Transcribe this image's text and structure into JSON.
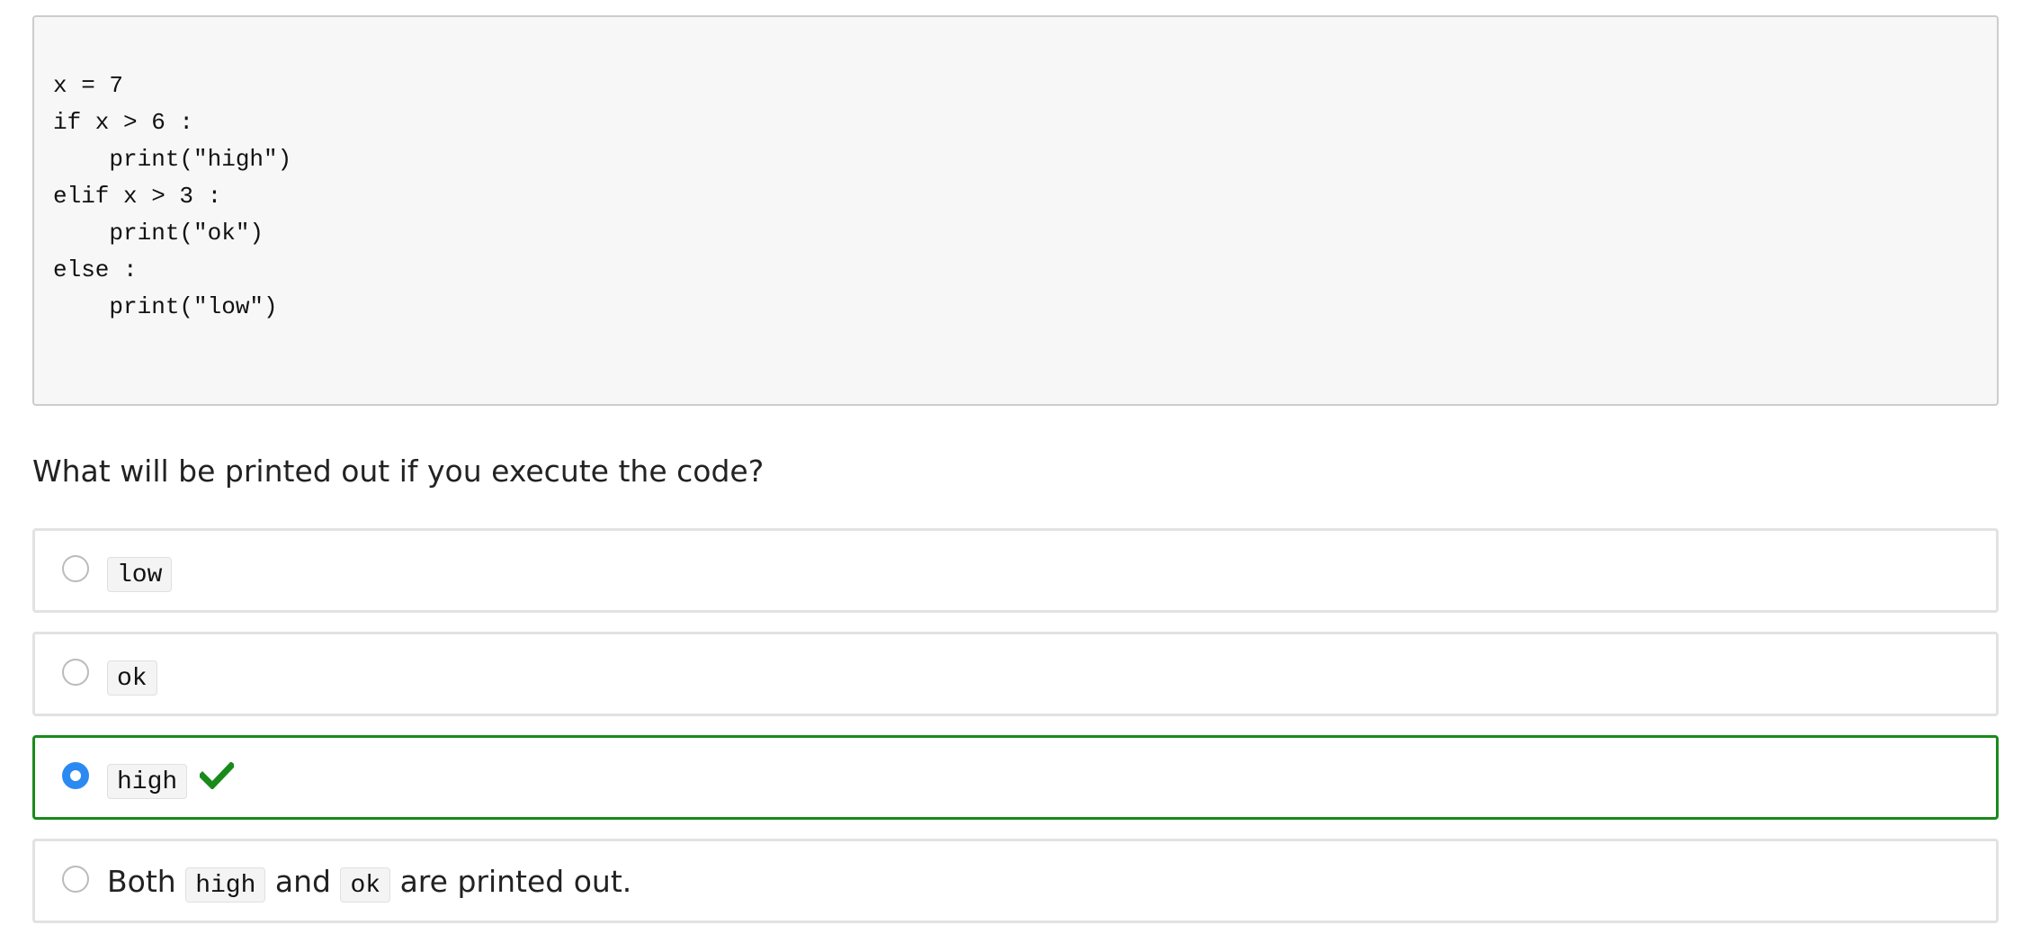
{
  "code": {
    "lines": [
      "x = 7",
      "if x > 6 :",
      "    print(\"high\")",
      "elif x > 3 :",
      "    print(\"ok\")",
      "else :",
      "    print(\"low\")"
    ]
  },
  "question": {
    "text": "What will be printed out if you execute the code?"
  },
  "options": [
    {
      "code": "low",
      "selected": false,
      "correct": false
    },
    {
      "code": "ok",
      "selected": false,
      "correct": false
    },
    {
      "code": "high",
      "selected": true,
      "correct": true
    },
    {
      "prefix": "Both ",
      "code1": "high",
      "middle": " and ",
      "code2": "ok",
      "suffix": " are printed out.",
      "selected": false,
      "correct": false
    }
  ],
  "colors": {
    "correct_border": "#1a8a1a",
    "check_icon": "#1a8a1a",
    "radio_selected": "#2b8af2",
    "code_background": "#f7f7f7"
  },
  "icons": {
    "correct": "checkmark-icon",
    "unselected": "radio-unchecked",
    "selected": "radio-checked"
  }
}
